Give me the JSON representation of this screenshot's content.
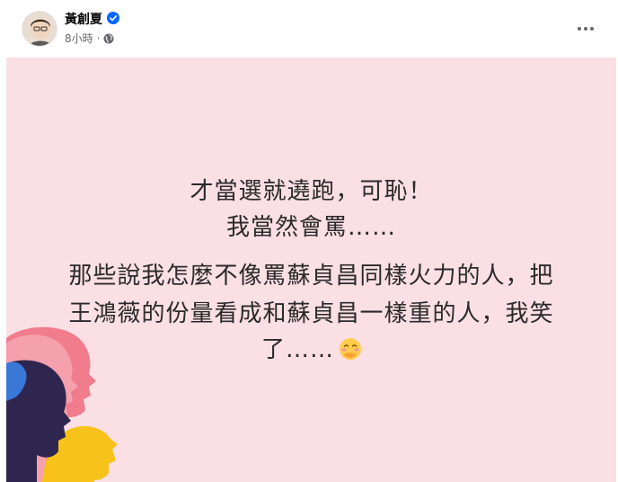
{
  "post": {
    "author": "黃創夏",
    "time": "8小時",
    "separator": "·",
    "privacy_icon": "globe-icon",
    "verified_icon": "verified-badge-icon",
    "more_icon": "more-options-icon"
  },
  "content": {
    "lines": [
      "才當選就遶跑，可恥！",
      "我當然會罵……",
      "那些說我怎麼不像罵蘇貞昌同樣火力的人，把",
      "王鴻薇的份量看成和蘇貞昌一樣重的人，我笑",
      "了……"
    ],
    "emoji": "face-with-hand-over-mouth-icon"
  },
  "colors": {
    "card_background": "#fadfe5",
    "verified_blue": "#0866ff",
    "text": "#2a2a2a"
  }
}
